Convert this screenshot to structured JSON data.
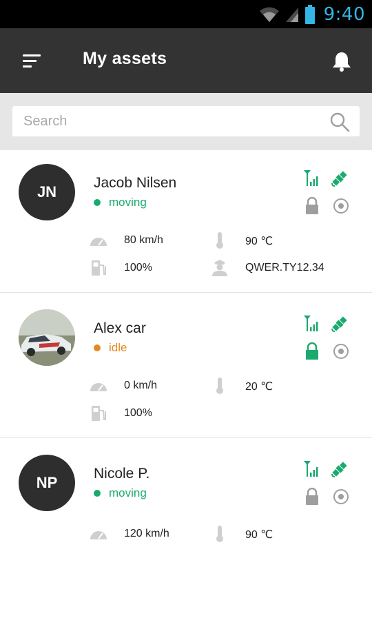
{
  "status_bar": {
    "time": "9:40",
    "time_color": "#33b5e5"
  },
  "app_bar": {
    "title": "My assets",
    "background": "#333333"
  },
  "search": {
    "placeholder": "Search",
    "value": ""
  },
  "colors": {
    "accent_green": "#1aaa6e",
    "idle_orange": "#e58a20",
    "muted_icon": "#9e9e9e"
  },
  "assets": [
    {
      "initials": "JN",
      "name": "Jacob Nilsen",
      "status": "moving",
      "speed": "80 km/h",
      "temperature": "90 ℃",
      "fuel": "100%",
      "driver_id": "QWER.TY12.34",
      "lock_active": false
    },
    {
      "initials": "",
      "name": "Alex car",
      "status": "idle",
      "speed": "0 km/h",
      "temperature": "20 ℃",
      "fuel": "100%",
      "lock_active": true
    },
    {
      "initials": "NP",
      "name": "Nicole P.",
      "status": "moving",
      "speed": "120 km/h",
      "temperature": "90 ℃",
      "lock_active": false
    }
  ]
}
